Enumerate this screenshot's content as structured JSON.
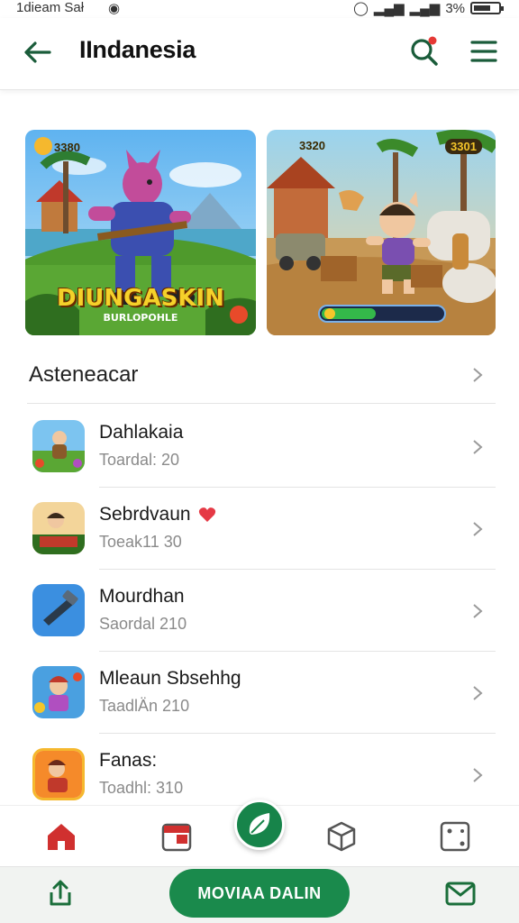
{
  "status_bar": {
    "left_text": "1dieam Sał",
    "right_text": "3%"
  },
  "app_bar": {
    "title": "IIndanesia"
  },
  "banners": [
    {
      "score": "3380",
      "title": "DIUNGASKIN",
      "subtitle": "BURLOPOHLE"
    },
    {
      "score": "3320",
      "badge": "3301",
      "progress": 0.45
    }
  ],
  "section": {
    "label": "Asteneacar"
  },
  "list": [
    {
      "name": "Dahlakaia",
      "sub": "Toardal: 20",
      "heart": false
    },
    {
      "name": "Sebrdvaun",
      "sub": "Toeak11 30",
      "heart": true
    },
    {
      "name": "Mourdhan",
      "sub": "Saordal 210",
      "heart": false
    },
    {
      "name": "Mleaun Sbsehhg",
      "sub": "TaadlÄn 210",
      "heart": false
    },
    {
      "name": "Fanas:",
      "sub": "Toadhl: 310",
      "heart": false
    }
  ],
  "bottom_nav": [
    "home-icon",
    "calendar-icon",
    "leaf-icon",
    "box-icon",
    "dice-icon"
  ],
  "action_bar": {
    "cta_label": "MOVIAA DALIN"
  },
  "colors": {
    "accent": "#17844a",
    "home_red": "#d0302f",
    "chevron": "#9a9a9a"
  }
}
